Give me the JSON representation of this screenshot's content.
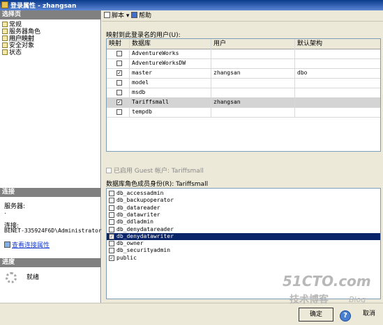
{
  "window": {
    "title": "登录属性 - zhangsan"
  },
  "left": {
    "select_page_header": "选择页",
    "nav": [
      "常规",
      "服务器角色",
      "用户映射",
      "安全对象",
      "状态"
    ],
    "selected_nav": 2,
    "connection_header": "连接",
    "server_label": "服务器:",
    "server_value": ".",
    "connection_label": "连接:",
    "connection_value": "BENET-335924F6D\\Administrator",
    "view_connection_link": "查看连接属性",
    "progress_header": "进度",
    "progress_status": "就绪"
  },
  "toolbar": {
    "script_label": "脚本",
    "help_label": "帮助"
  },
  "mapping": {
    "label": "映射到此登录名的用户(U):",
    "columns": [
      "映射",
      "数据库",
      "用户",
      "默认架构"
    ],
    "rows": [
      {
        "mapped": false,
        "db": "AdventureWorks",
        "user": "",
        "schema": ""
      },
      {
        "mapped": false,
        "db": "AdventureWorksDW",
        "user": "",
        "schema": ""
      },
      {
        "mapped": true,
        "db": "master",
        "user": "zhangsan",
        "schema": "dbo"
      },
      {
        "mapped": false,
        "db": "model",
        "user": "",
        "schema": ""
      },
      {
        "mapped": false,
        "db": "msdb",
        "user": "",
        "schema": ""
      },
      {
        "mapped": true,
        "db": "Tariffsmall",
        "user": "zhangsan",
        "schema": ""
      },
      {
        "mapped": false,
        "db": "tempdb",
        "user": "",
        "schema": ""
      }
    ],
    "selected_row": 5
  },
  "guest": {
    "label": "已启用 Guest 帐户: Tariffsmall",
    "checked": false
  },
  "roles": {
    "label": "数据库角色成员身份(R): Tariffsmall",
    "items": [
      {
        "name": "db_accessadmin",
        "checked": false
      },
      {
        "name": "db_backupoperator",
        "checked": false
      },
      {
        "name": "db_datareader",
        "checked": false
      },
      {
        "name": "db_datawriter",
        "checked": false
      },
      {
        "name": "db_ddladmin",
        "checked": false
      },
      {
        "name": "db_denydatareader",
        "checked": false
      },
      {
        "name": "db_denydatawriter",
        "checked": true
      },
      {
        "name": "db_owner",
        "checked": false
      },
      {
        "name": "db_securityadmin",
        "checked": false
      },
      {
        "name": "public",
        "checked": true
      }
    ],
    "selected_index": 6
  },
  "buttons": {
    "ok_label": "确定",
    "cancel_label": "取消"
  },
  "watermark": {
    "brand": "51CTO.com",
    "sub": "技术博客",
    "blog": "Blog"
  }
}
